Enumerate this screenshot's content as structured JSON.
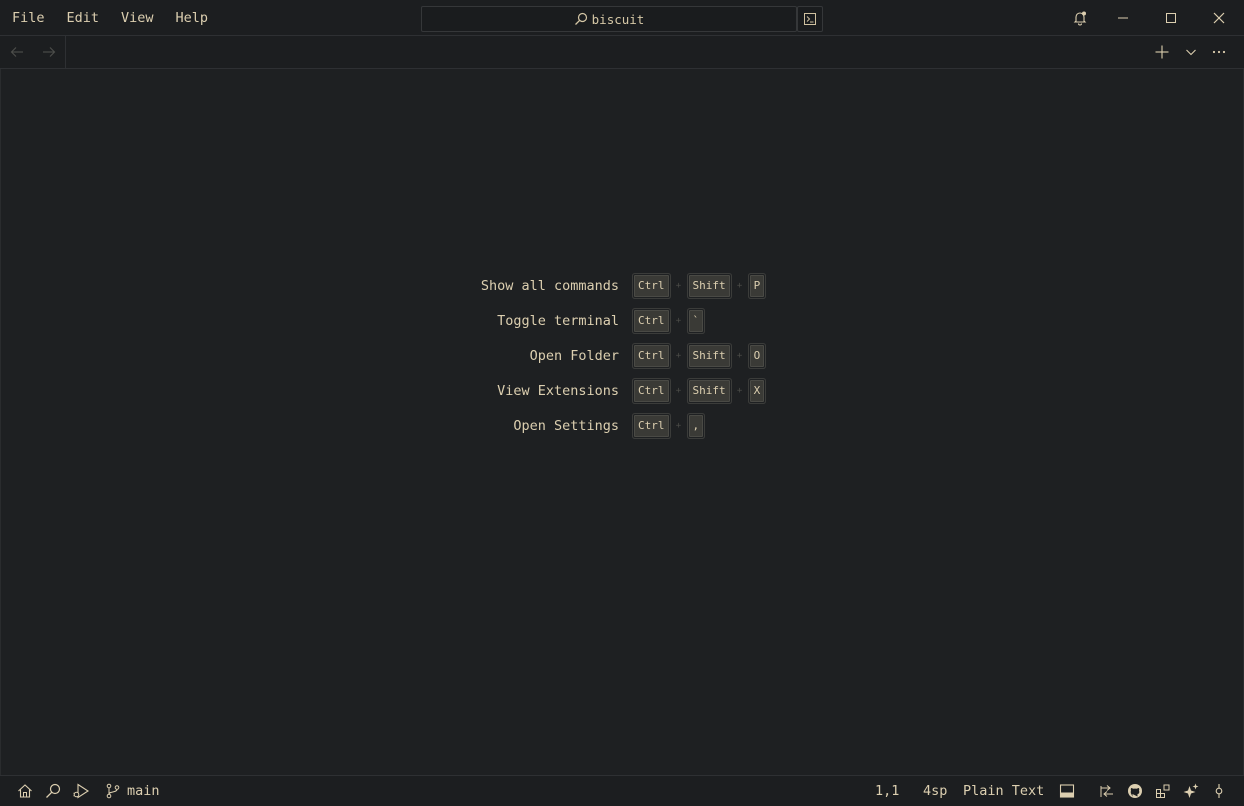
{
  "menu": [
    {
      "label": "File"
    },
    {
      "label": "Edit"
    },
    {
      "label": "View"
    },
    {
      "label": "Help"
    }
  ],
  "search": {
    "text": "biscuit",
    "icon": "search-icon"
  },
  "window_controls": [
    "bell-icon",
    "minimize-icon",
    "maximize-icon",
    "close-icon"
  ],
  "shortcuts": [
    {
      "label": "Show all commands",
      "keys": [
        "Ctrl",
        "Shift",
        "P"
      ]
    },
    {
      "label": "Toggle terminal",
      "keys": [
        "Ctrl",
        "`"
      ]
    },
    {
      "label": "Open Folder",
      "keys": [
        "Ctrl",
        "Shift",
        "O"
      ]
    },
    {
      "label": "View Extensions",
      "keys": [
        "Ctrl",
        "Shift",
        "X"
      ]
    },
    {
      "label": "Open Settings",
      "keys": [
        "Ctrl",
        ","
      ]
    }
  ],
  "key_separator": "+",
  "status": {
    "branch": "main",
    "cursor": "1,1",
    "indent": "4sp",
    "language": "Plain Text"
  },
  "colors": {
    "background": "#1e2022",
    "text": "#dccfb0",
    "border": "#2e3033"
  }
}
